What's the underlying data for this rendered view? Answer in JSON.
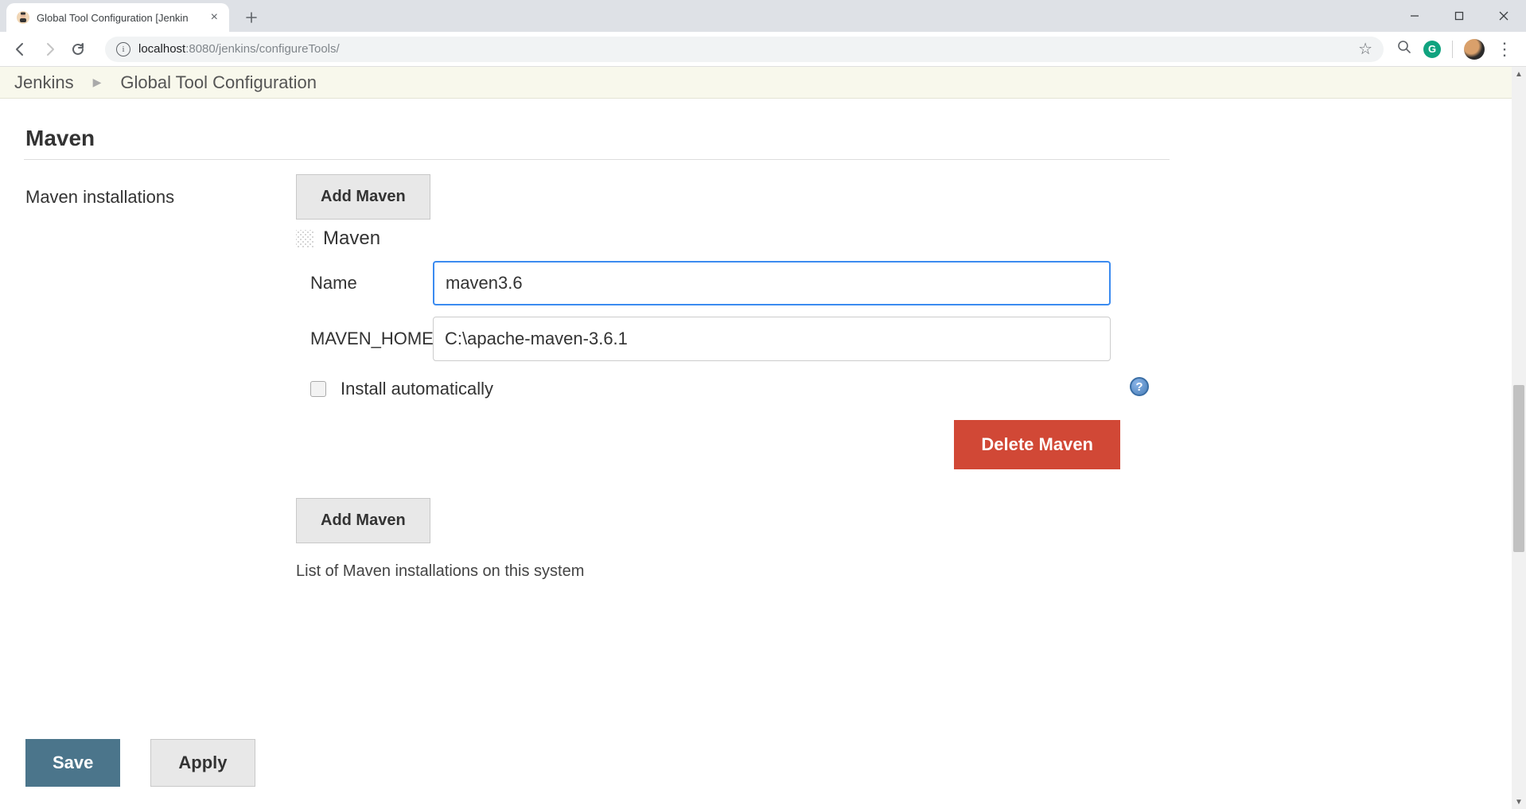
{
  "browser": {
    "tab_title": "Global Tool Configuration [Jenkin",
    "url_host": "localhost",
    "url_port": ":8080",
    "url_path": "/jenkins/configureTools/"
  },
  "breadcrumb": {
    "root": "Jenkins",
    "page": "Global Tool Configuration"
  },
  "maven": {
    "section_title": "Maven",
    "row_label": "Maven installations",
    "add_button": "Add Maven",
    "tool_title": "Maven",
    "fields": {
      "name_label": "Name",
      "name_value": "maven3.6",
      "home_label": "MAVEN_HOME",
      "home_value": "C:\\apache-maven-3.6.1"
    },
    "install_auto_label": "Install automatically",
    "install_auto_checked": false,
    "delete_button": "Delete Maven",
    "list_caption": "List of Maven installations on this system"
  },
  "actions": {
    "save": "Save",
    "apply": "Apply"
  }
}
